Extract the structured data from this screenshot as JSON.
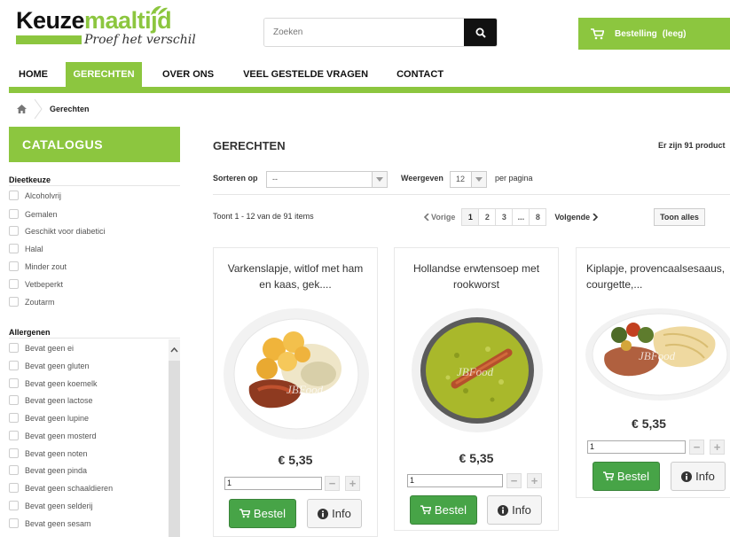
{
  "logo": {
    "main_dark": "Keuze",
    "main_green": "maaltijd",
    "tagline": "Proef het verschil"
  },
  "search": {
    "placeholder": "Zoeken",
    "icon": "search-icon"
  },
  "cart": {
    "label": "Bestelling",
    "state": "(leeg)",
    "icon": "cart-icon"
  },
  "nav": {
    "items": [
      {
        "label": "HOME"
      },
      {
        "label": "GERECHTEN"
      },
      {
        "label": "OVER ONS"
      },
      {
        "label": "VEEL GESTELDE VRAGEN"
      },
      {
        "label": "CONTACT"
      }
    ],
    "active": "GERECHTEN"
  },
  "breadcrumb": {
    "current": "Gerechten",
    "home_icon": "home-icon"
  },
  "sidebar": {
    "title": "CATALOGUS",
    "groups": [
      {
        "title": "Dieetkeuze",
        "items": [
          "Alcoholvrij",
          "Gemalen",
          "Geschikt voor diabetici",
          "Halal",
          "Minder zout",
          "Vetbeperkt",
          "Zoutarm"
        ]
      },
      {
        "title": "Allergenen",
        "items": [
          "Bevat geen ei",
          "Bevat geen gluten",
          "Bevat geen koemelk",
          "Bevat geen lactose",
          "Bevat geen lupine",
          "Bevat geen mosterd",
          "Bevat geen noten",
          "Bevat geen pinda",
          "Bevat geen schaaldieren",
          "Bevat geen selderij",
          "Bevat geen sesam"
        ]
      }
    ]
  },
  "main": {
    "title": "GERECHTEN",
    "count": "Er zijn 91 product",
    "sort_label": "Sorteren op",
    "sort_value": "--",
    "show_label": "Weergeven",
    "show_value": "12",
    "per_page": "per pagina",
    "showing": "Toont 1 - 12 van de 91 items",
    "pagination": {
      "prev": "Vorige",
      "pages": [
        "1",
        "2",
        "3",
        "...",
        "8"
      ],
      "next": "Volgende",
      "current": "1"
    },
    "show_all": "Toon alles"
  },
  "products": [
    {
      "name": "Varkenslapje, witlof met ham en kaas, gek....",
      "price": "€ 5,35",
      "qty": "1",
      "order": "Bestel",
      "info": "Info"
    },
    {
      "name": "Hollandse erwtensoep met rookworst",
      "price": "€ 5,35",
      "qty": "1",
      "order": "Bestel",
      "info": "Info"
    },
    {
      "name": "Kiplapje, provencaalsesaaus, courgette,...",
      "price": "€ 5,35",
      "qty": "1",
      "order": "Bestel",
      "info": "Info"
    }
  ],
  "watermark": "JBFood",
  "colors": {
    "brand_green": "#8cc63f",
    "button_green": "#47a447",
    "dark": "#111111"
  }
}
